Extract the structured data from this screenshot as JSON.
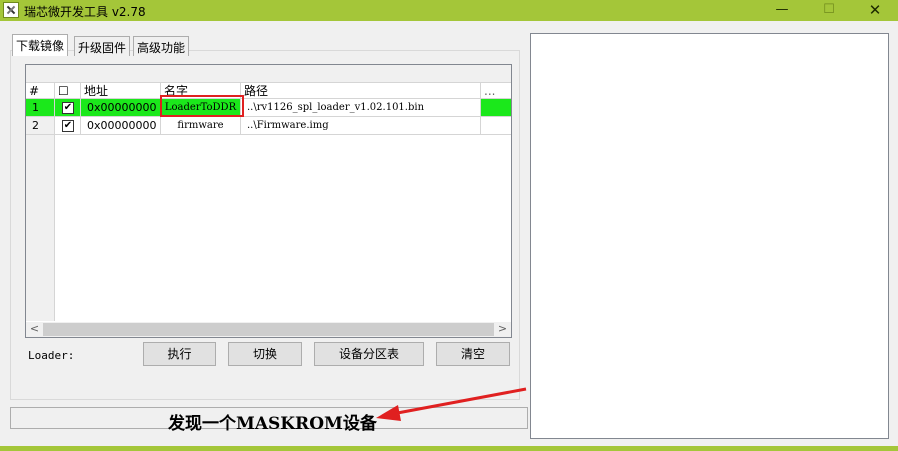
{
  "window": {
    "title": "瑞芯微开发工具 v2.78",
    "minimize_glyph": "—",
    "maximize_glyph": "☐",
    "close_glyph": "✕",
    "titlebar_color": "#a4c639"
  },
  "tabs": [
    {
      "label": "下载镜像",
      "active": true
    },
    {
      "label": "升级固件",
      "active": false
    },
    {
      "label": "高级功能",
      "active": false
    }
  ],
  "grid": {
    "columns": [
      "#",
      "☐",
      "地址",
      "名字",
      "路径",
      "..."
    ],
    "rows": [
      {
        "index": "1",
        "checked": true,
        "address": "0x00000000",
        "name": "LoaderToDDR",
        "path": "..\\rv1126_spl_loader_v1.02.101.bin",
        "highlight_color": "#1be81b"
      },
      {
        "index": "2",
        "checked": true,
        "address": "0x00000000",
        "name": "firmware",
        "path": "..\\Firmware.img"
      }
    ],
    "scroll_left_glyph": "<",
    "scroll_right_glyph": ">",
    "checkmark": "✔"
  },
  "loader_label": "Loader:",
  "buttons": {
    "run": "执行",
    "switch": "切换",
    "partition": "设备分区表",
    "clear": "清空"
  },
  "status": "发现一个MASKROM设备",
  "annotation_color": "#e02020"
}
